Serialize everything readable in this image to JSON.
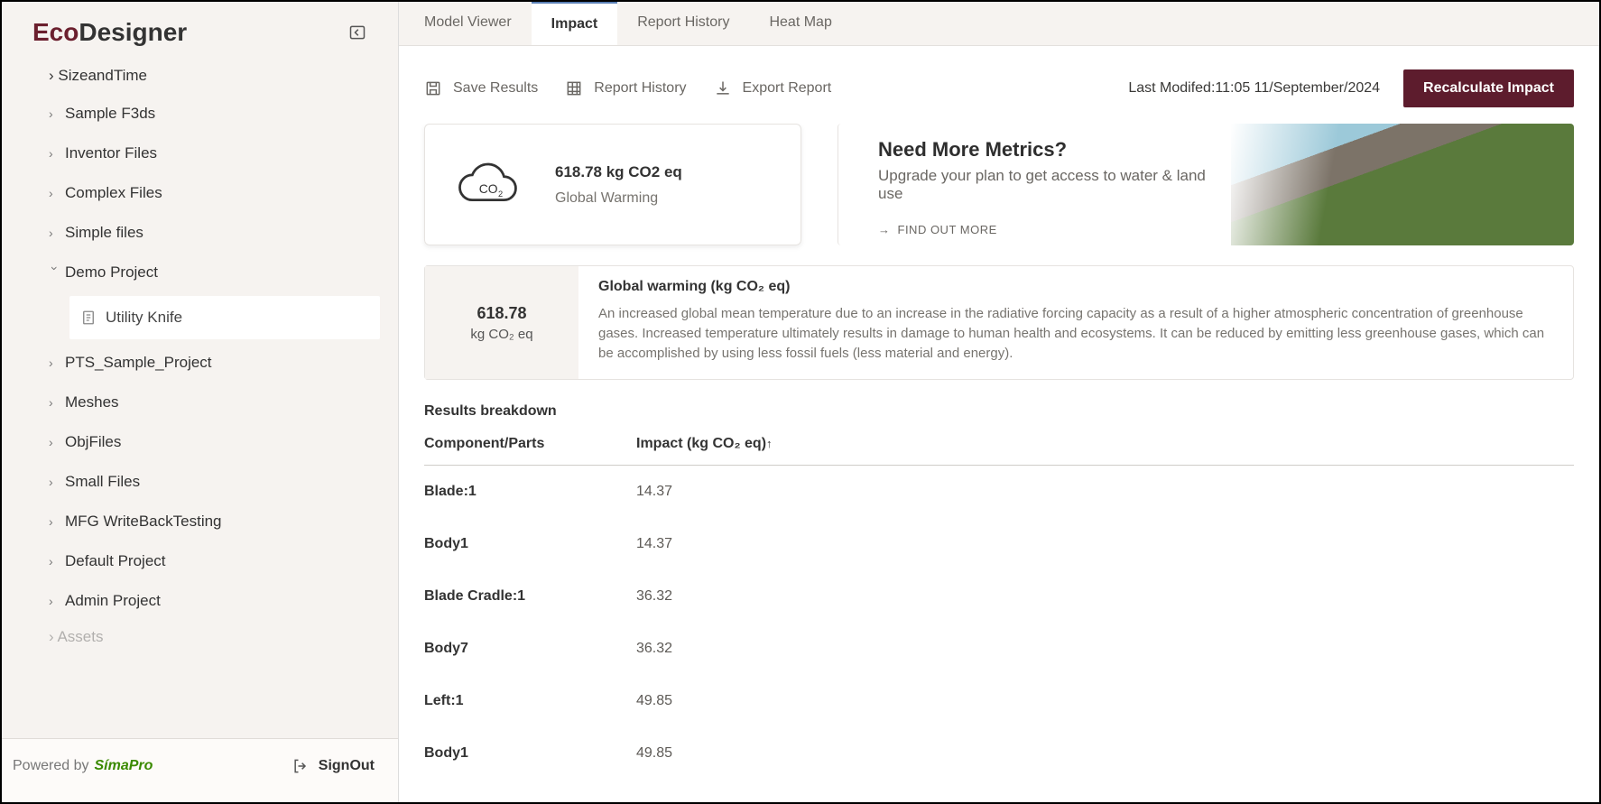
{
  "app": {
    "logo_prefix": "Eco",
    "logo_suffix": "Designer"
  },
  "sidebar": {
    "peek_top": "SizeandTime",
    "items": [
      {
        "label": "Sample F3ds",
        "expanded": false
      },
      {
        "label": "Inventor Files",
        "expanded": false
      },
      {
        "label": "Complex Files",
        "expanded": false
      },
      {
        "label": "Simple files",
        "expanded": false
      },
      {
        "label": "Demo Project",
        "expanded": true,
        "child": "Utility Knife"
      },
      {
        "label": "PTS_Sample_Project",
        "expanded": false
      },
      {
        "label": "Meshes",
        "expanded": false
      },
      {
        "label": "ObjFiles",
        "expanded": false
      },
      {
        "label": "Small Files",
        "expanded": false
      },
      {
        "label": "MFG WriteBackTesting",
        "expanded": false
      },
      {
        "label": "Default Project",
        "expanded": false
      },
      {
        "label": "Admin Project",
        "expanded": false
      }
    ],
    "peek_bottom": "Assets",
    "powered_by": "Powered by",
    "powered_brand": "SímaPro",
    "signout": "SignOut"
  },
  "tabs": [
    {
      "label": "Model Viewer",
      "active": false
    },
    {
      "label": "Impact",
      "active": true
    },
    {
      "label": "Report History",
      "active": false
    },
    {
      "label": "Heat Map",
      "active": false
    }
  ],
  "toolbar": {
    "save": "Save Results",
    "history": "Report History",
    "export": "Export Report",
    "last_modified": "Last Modifed:11:05 11/September/2024",
    "recalc": "Recalculate Impact"
  },
  "metric": {
    "value": "618.78 kg CO2 eq",
    "label": "Global Warming"
  },
  "promo": {
    "title": "Need More Metrics?",
    "subtitle": "Upgrade your plan to get access to water & land use",
    "cta": "FIND OUT MORE"
  },
  "detail": {
    "big_value": "618.78",
    "unit": "kg CO₂ eq",
    "title": "Global warming (kg CO₂ eq)",
    "desc": "An increased global mean temperature due to an increase in the radiative forcing capacity as a result of a higher atmospheric concentration of greenhouse gases. Increased temperature ultimately results in damage to human health and ecosystems. It can be reduced by emitting less greenhouse gases, which can be accomplished by using less fossil fuels (less material and energy)."
  },
  "results": {
    "title": "Results breakdown",
    "col_part": "Component/Parts",
    "col_impact": "Impact (kg CO₂ eq)",
    "sort_indicator": "↑",
    "rows": [
      {
        "part": "Blade:1",
        "impact": "14.37"
      },
      {
        "part": "Body1",
        "impact": "14.37"
      },
      {
        "part": "Blade Cradle:1",
        "impact": "36.32"
      },
      {
        "part": "Body7",
        "impact": "36.32"
      },
      {
        "part": "Left:1",
        "impact": "49.85"
      },
      {
        "part": "Body1",
        "impact": "49.85"
      }
    ]
  }
}
